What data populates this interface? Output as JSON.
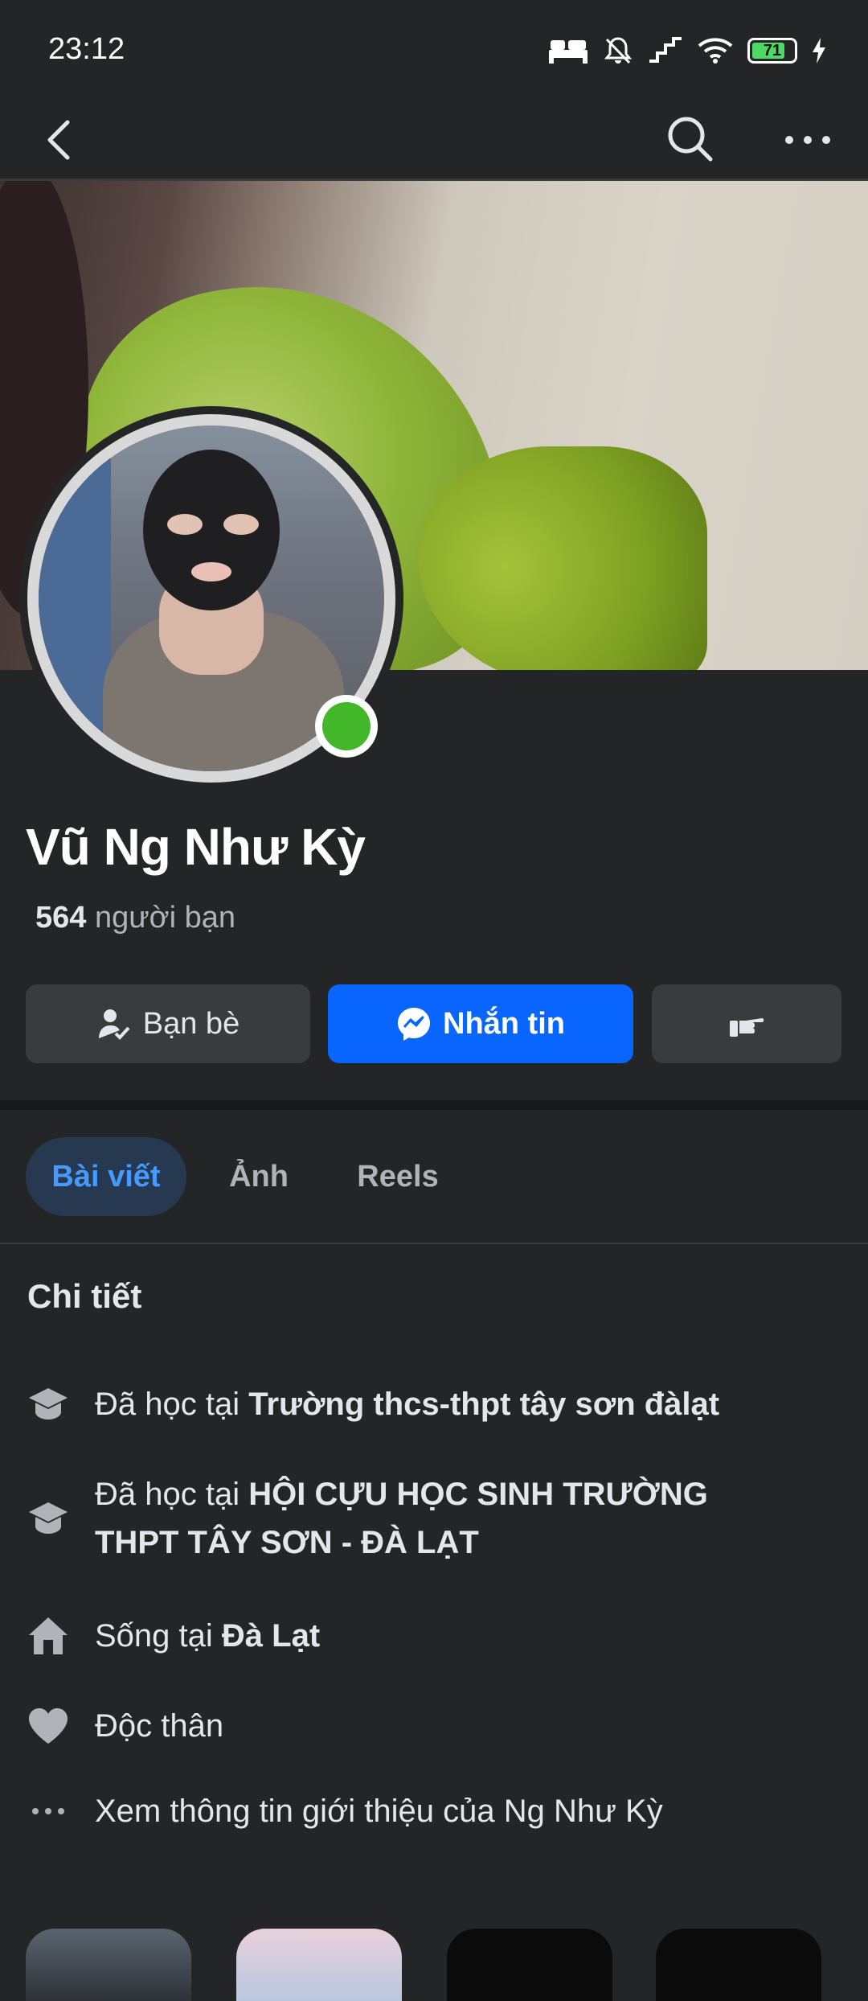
{
  "status_bar": {
    "time": "23:12",
    "battery": "71"
  },
  "profile": {
    "name": "Vũ Ng Như Kỳ",
    "friends_count": "564",
    "friends_label": "người bạn"
  },
  "actions": {
    "friends_label": "Bạn bè",
    "message_label": "Nhắn tin"
  },
  "tabs": [
    "Bài viết",
    "Ảnh",
    "Reels"
  ],
  "details": {
    "title": "Chi tiết",
    "items": [
      {
        "icon": "education-icon",
        "prefix": "Đã học tại ",
        "bold": "Trường thcs-thpt tây sơn đàlạt"
      },
      {
        "icon": "education-icon",
        "prefix": "Đã học tại ",
        "bold": "HỘI CỰU HỌC SINH TRƯỜNG THPT TÂY SƠN - ĐÀ LẠT"
      },
      {
        "icon": "home-icon",
        "prefix": "Sống tại ",
        "bold": "Đà Lạt"
      },
      {
        "icon": "heart-icon",
        "prefix": "Độc thân",
        "bold": ""
      },
      {
        "icon": "more-dots-icon",
        "prefix": "Xem thông tin giới thiệu của Ng Như Kỳ",
        "bold": ""
      }
    ]
  },
  "colors": {
    "accent": "#0866ff",
    "online": "#42b72a",
    "background": "#242526"
  }
}
